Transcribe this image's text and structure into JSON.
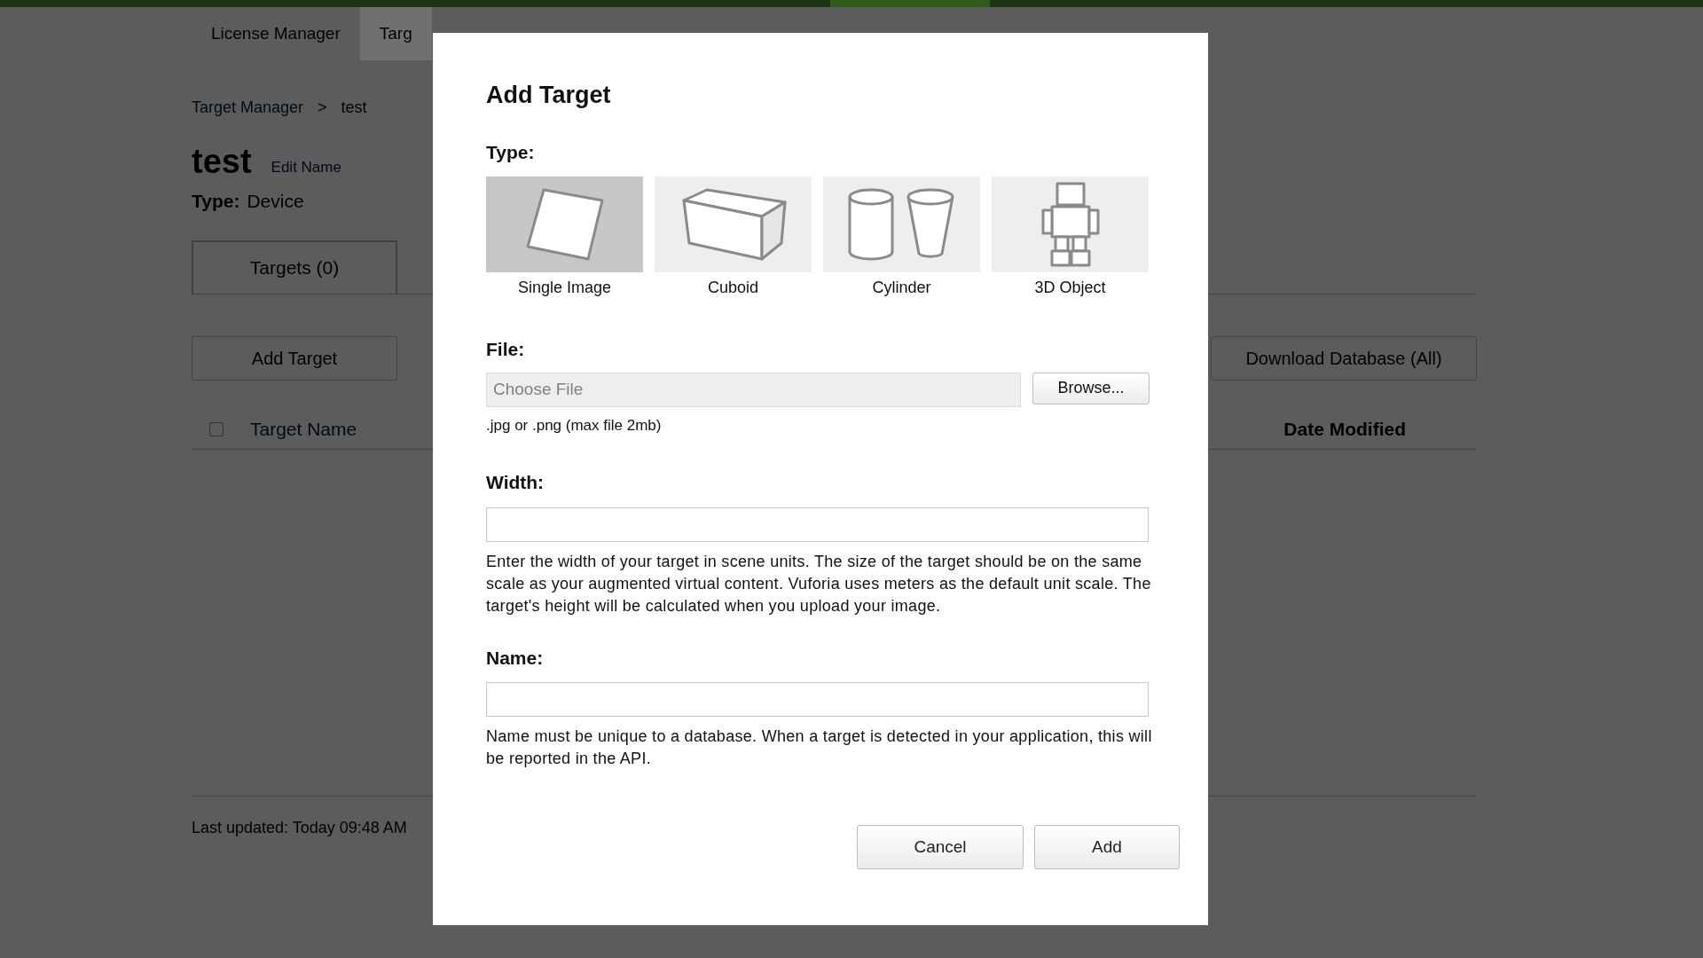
{
  "top_tabs": [
    {
      "label": "License Manager",
      "selected": false
    },
    {
      "label": "Targ",
      "selected": true
    }
  ],
  "breadcrumb": {
    "link": "Target Manager",
    "separator": ">",
    "current": "test"
  },
  "database": {
    "name": "test",
    "edit_link": "Edit Name",
    "type_label": "Type:",
    "type_value": "Device"
  },
  "section_tabs": [
    {
      "label": "Targets (0)",
      "selected": true
    }
  ],
  "actions": [
    "Add Target",
    "Download Database (All)"
  ],
  "table": {
    "select_all_checked": false,
    "columns": [
      "Target Name",
      "Date Modified"
    ]
  },
  "footer": "Last updated: Today 09:48 AM",
  "dialog": {
    "title": "Add Target",
    "type_label": "Type:",
    "types": [
      {
        "kind": "image",
        "label": "Single Image",
        "selected": true
      },
      {
        "kind": "cuboid",
        "label": "Cuboid",
        "selected": false
      },
      {
        "kind": "cylinder",
        "label": "Cylinder",
        "selected": false
      },
      {
        "kind": "object",
        "label": "3D Object",
        "selected": false
      }
    ],
    "file_label": "File:",
    "file_placeholder": "Choose File",
    "browse": "Browse...",
    "file_hint": ".jpg or .png (max file 2mb)",
    "width_label": "Width:",
    "width_help": "Enter the width of your target in scene units. The size of the target should be on the same scale as your augmented virtual content. Vuforia uses meters as the default unit scale. The target's height will be calculated when you upload your image.",
    "name_label": "Name:",
    "name_help": "Name must be unique to a database. When a target is detected in your application, this will be reported in the API.",
    "buttons": [
      "Cancel",
      "Add"
    ]
  }
}
